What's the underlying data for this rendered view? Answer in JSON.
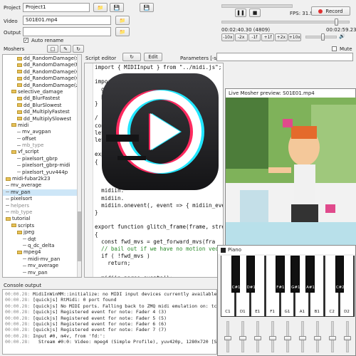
{
  "project": {
    "label": "Project",
    "value": "Project1"
  },
  "video": {
    "label": "Video",
    "value": "S01E01.mp4"
  },
  "output": {
    "label": "Output",
    "value": ""
  },
  "auto_rename": {
    "label": "Auto rename",
    "checked": true
  },
  "player": {
    "fps": "FPS: 31.9",
    "record_label": "Record",
    "time": "00:02:40.30 (4809)",
    "total": "00:02:59.23",
    "speeds": [
      "-10x",
      "-2x",
      "-1f",
      "+1f",
      "+2x",
      "+10x"
    ],
    "mute_label": "Mute"
  },
  "moshers": {
    "title": "Moshers",
    "items": [
      {
        "label": "dd_RandomDamage(sw",
        "indent": 2,
        "type": "folder"
      },
      {
        "label": "dd_RandomDamage(twi",
        "indent": 2,
        "type": "folder"
      },
      {
        "label": "dd_RandomDamage(wa",
        "indent": 2,
        "type": "folder"
      },
      {
        "label": "dd_RandomDamage(wa",
        "indent": 2,
        "type": "folder"
      },
      {
        "label": "dd_RandomDamage(zoo",
        "indent": 2,
        "type": "folder"
      },
      {
        "label": "selective_damage",
        "indent": 1,
        "type": "folder-open"
      },
      {
        "label": "dd_BlurFastest",
        "indent": 2,
        "type": "folder"
      },
      {
        "label": "dd_BlurSlowest",
        "indent": 2,
        "type": "folder"
      },
      {
        "label": "dd_MultiplyFastest",
        "indent": 2,
        "type": "folder"
      },
      {
        "label": "dd_MultiplySlowest",
        "indent": 2,
        "type": "folder"
      },
      {
        "label": "midi",
        "indent": 1,
        "type": "folder-open"
      },
      {
        "label": "mv_avgpan",
        "indent": 2,
        "type": "file"
      },
      {
        "label": "offset",
        "indent": 2,
        "type": "file"
      },
      {
        "label": "mb_type",
        "indent": 2,
        "type": "file",
        "grey": true
      },
      {
        "label": "vf_script",
        "indent": 1,
        "type": "folder-open"
      },
      {
        "label": "pixelsort_gbrp",
        "indent": 2,
        "type": "file"
      },
      {
        "label": "pixelsort_gbrp-midi",
        "indent": 2,
        "type": "file"
      },
      {
        "label": "pixelsort_yuv444p",
        "indent": 2,
        "type": "file"
      },
      {
        "label": "midi-fubar2k23",
        "indent": 0,
        "type": "folder"
      },
      {
        "label": "mv_average",
        "indent": 0,
        "type": "file"
      },
      {
        "label": "mv_pan",
        "indent": 0,
        "type": "file",
        "selected": true
      },
      {
        "label": "pixelsort",
        "indent": 0,
        "type": "file"
      },
      {
        "label": "helpers",
        "indent": 0,
        "type": "file",
        "grey": true
      },
      {
        "label": "mb_type",
        "indent": 0,
        "type": "file",
        "grey": true
      },
      {
        "label": "tutorial",
        "indent": 0,
        "type": "folder-open"
      },
      {
        "label": "scripts",
        "indent": 1,
        "type": "folder-open"
      },
      {
        "label": "jpeg",
        "indent": 2,
        "type": "folder-open"
      },
      {
        "label": "dqt",
        "indent": 3,
        "type": "file"
      },
      {
        "label": "q_dc_delta",
        "indent": 3,
        "type": "file"
      },
      {
        "label": "mpeg4",
        "indent": 2,
        "type": "folder-open"
      },
      {
        "label": "midi-mv_pan",
        "indent": 3,
        "type": "file"
      },
      {
        "label": "mv_average",
        "indent": 3,
        "type": "file"
      },
      {
        "label": "mv_pan",
        "indent": 3,
        "type": "file"
      }
    ]
  },
  "script_editor": {
    "title": "Script editor",
    "edit_label": "Edit",
    "params_label": "Parameters [-sp]",
    "lines": [
      "import { MIDIInput } from \"../midi.js\";",
      "",
      "import",
      "  get",
      "  p",
      "}",
      "",
      "/",
      "cons",
      "let",
      "let",
      "",
      "exp",
      "{",
      "",
      "",
      "",
      "  midiin.",
      "  midiin.",
      "  midiin.onevent(, event => { midiin_eve",
      "}",
      "",
      "export function glitch_frame(frame, stre",
      "{",
      "  const fwd_mvs = get_forward_mvs(fra",
      "  // bail out if we have no motion vec",
      "  if ( !fwd_mvs )",
      "    return;",
      "",
      "  midiin.parse_events();",
      "",
      "  const height = 64;",
      "  const width = 64;"
    ]
  },
  "preview": {
    "title": "Live Mosher preview: S01E01.mp4"
  },
  "piano": {
    "title": "Piano",
    "white_keys": [
      "C1",
      "D1",
      "E1",
      "F1",
      "G1",
      "A1",
      "B1",
      "C2",
      "D2"
    ],
    "black_keys": [
      {
        "label": "C#1",
        "after": 0
      },
      {
        "label": "D#1",
        "after": 1
      },
      {
        "label": "F#1",
        "after": 3
      },
      {
        "label": "G#1",
        "after": 4
      },
      {
        "label": "A#1",
        "after": 5
      },
      {
        "label": "C#2",
        "after": 7
      }
    ]
  },
  "console": {
    "title": "Console output",
    "lines": [
      {
        "t": "00:00.28:",
        "m": "MidiInWinMM::initialize: no MIDI input devices currently available."
      },
      {
        "t": "00:00.28:",
        "m": "[quickjs] RtMidi: 0 port found"
      },
      {
        "t": "00:00.28:",
        "m": "[quickjs] No MIDI ports. Falling back to ZMQ midi emulation on: tcp://"
      },
      {
        "t": "00:00.28:",
        "m": "[quickjs] Registered event for note: Fader 4 (3)"
      },
      {
        "t": "00:00.28:",
        "m": "[quickjs] Registered event for note: Fader 5 (5)"
      },
      {
        "t": "00:00.28:",
        "m": "[quickjs] Registered event for note: Fader 6 (6)"
      },
      {
        "t": "00:00.28:",
        "m": "[quickjs] Registered event for note: Fader 7 (7)"
      },
      {
        "t": "00:00.28:",
        "m": "Input #0, m4v, from 'fd:':"
      },
      {
        "t": "00:00.28:",
        "m": "  Stream #0:0: Video: mpeg4 (Simple Profile), yuv420p, 1280x720 [SAR 1:"
      }
    ]
  },
  "colors": {
    "accent": "#2a6fb8",
    "record": "#e03030",
    "selection": "#cde6f7"
  },
  "sliders": [
    {
      "level": 0.45
    },
    {
      "level": 0.45
    },
    {
      "level": 0.45
    },
    {
      "level": 0.45
    },
    {
      "level": 0.45
    },
    {
      "level": 0.45
    },
    {
      "level": 0.45
    },
    {
      "level": 0.45
    },
    {
      "level": 0.45
    }
  ]
}
